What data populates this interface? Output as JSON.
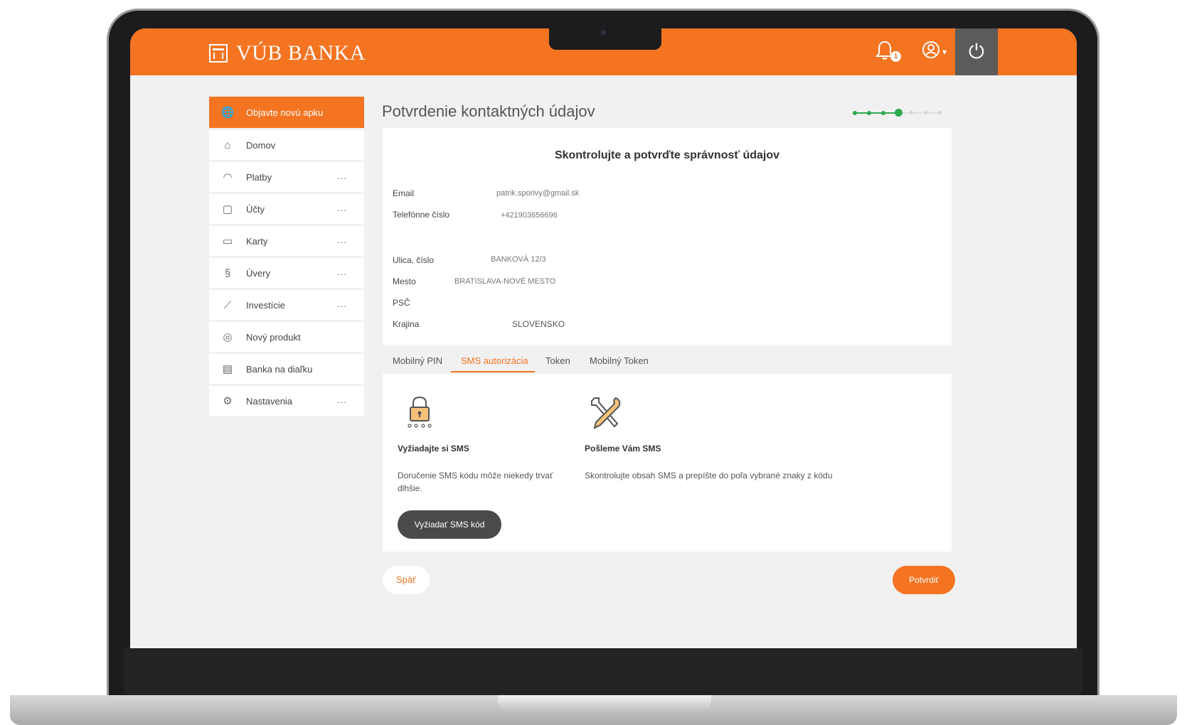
{
  "header": {
    "logo_text": "VÚB BANKA",
    "notification_count": "1",
    "power_label": "⏻"
  },
  "sidebar": {
    "items": [
      {
        "label": "Objavte novú apku",
        "icon": "globe-icon",
        "glyph": "🌐",
        "dots": ""
      },
      {
        "label": "Domov",
        "icon": "home-icon",
        "glyph": "⌂",
        "dots": ""
      },
      {
        "label": "Platby",
        "icon": "payments-icon",
        "glyph": "◠",
        "dots": "..."
      },
      {
        "label": "Účty",
        "icon": "wallet-icon",
        "glyph": "▢",
        "dots": "..."
      },
      {
        "label": "Karty",
        "icon": "card-icon",
        "glyph": "▭",
        "dots": "..."
      },
      {
        "label": "Úvery",
        "icon": "loan-icon",
        "glyph": "§",
        "dots": "..."
      },
      {
        "label": "Investície",
        "icon": "chart-icon",
        "glyph": "⟋",
        "dots": "..."
      },
      {
        "label": "Nový produkt",
        "icon": "product-icon",
        "glyph": "◎",
        "dots": ""
      },
      {
        "label": "Banka na diaľku",
        "icon": "clipboard-icon",
        "glyph": "▤",
        "dots": ""
      },
      {
        "label": "Nastavenia",
        "icon": "gear-icon",
        "glyph": "⚙",
        "dots": "..."
      }
    ]
  },
  "main": {
    "title": "Potvrdenie kontaktných údajov",
    "progress": {
      "current_step": 4,
      "total_steps": 7
    },
    "card": {
      "heading": "Skontrolujte a potvrďte správnosť údajov",
      "email_label": "Email",
      "email_value": "patrik.sporivy@gmail.sk",
      "phone_label": "Telefónne číslo",
      "phone_value": "+421903656696",
      "street_label": "Ulica, číslo",
      "street_value": "BANKOVÁ 12/3",
      "city_label": "Mesto",
      "city_value": "BRATISLAVA-NOVÉ MESTO",
      "zip_label": "PSČ",
      "country_label": "Krajina",
      "country_value": "SLOVENSKO"
    },
    "tabs": [
      "Mobilný PIN",
      "SMS autorizácia",
      "Token",
      "Mobilný Token"
    ],
    "active_tab": 1,
    "panel": {
      "left_heading": "Vyžiadajte si SMS",
      "left_text": "Doručenie SMS kódu môže niekedy trvať dlhšie.",
      "left_button": "Vyžiadať SMS kód",
      "right_heading": "Pošleme Vám SMS",
      "right_text": "Skontrolujte obsah SMS a prepíšte do poľa vybrané znaky z kódu"
    },
    "back_button": "Späť",
    "confirm_button": "Potvrdiť"
  },
  "colors": {
    "brand": "#f47421",
    "progress": "#2fa84f",
    "dark_button": "#4a4a4a"
  }
}
